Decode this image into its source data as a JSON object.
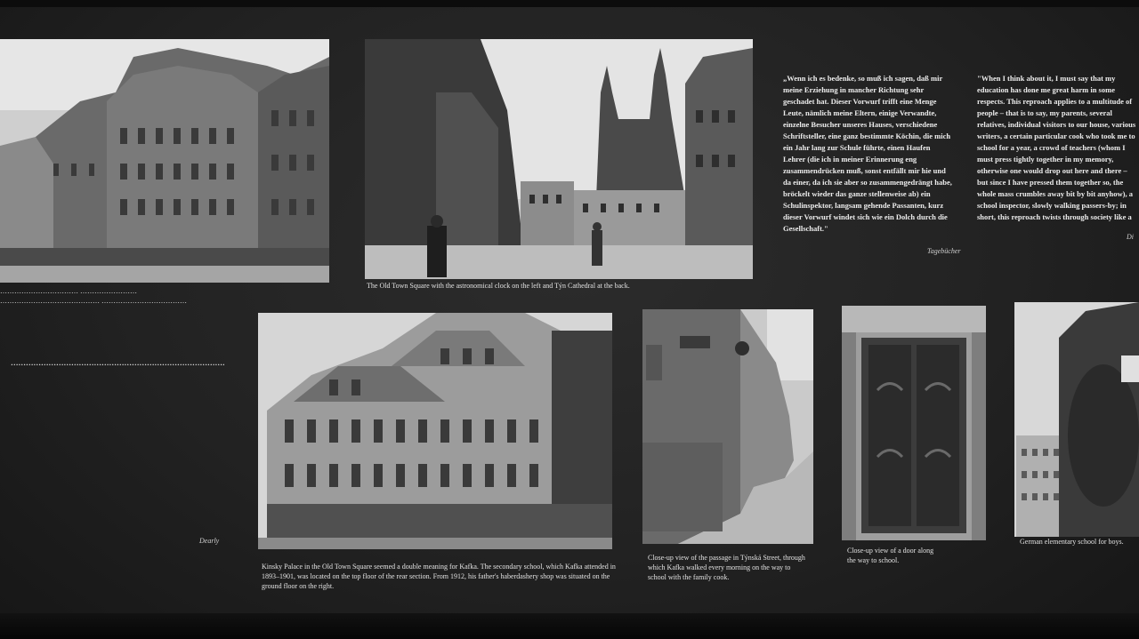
{
  "captions": {
    "top_left": "…………………………… …………………… …………………………………… ……………………………… ………………",
    "old_town_square": "The Old Town Square with the astronomical clock on the left and Týn Cathedral at the back.",
    "kinsky_palace": "Kinsky Palace in the Old Town Square seemed a double meaning for Kafka. The secondary school, which Kafka attended in 1893–1901, was located on the top floor of the rear section. From 1912, his father's haberdashery shop was situated on the ground floor on the right.",
    "passage": "Close-up view of the passage in Týnská Street, through which Kafka walked every morning on the way to school with the family cook.",
    "door": "Close-up view of a door along the way to school.",
    "school": "German elementary school for boys."
  },
  "quotes": {
    "german": "„Wenn ich es bedenke, so muß ich sagen, daß mir meine Erziehung in mancher Richtung sehr geschadet hat. Dieser Vorwurf trifft eine Menge Leute, nämlich meine Eltern, einige Verwandte, einzelne Besucher unseres Hauses, verschiedene Schriftsteller, eine ganz bestimmte Köchin, die mich ein Jahr lang zur Schule führte, einen Haufen Lehrer (die ich in meiner Erinnerung eng zusammendrücken muß, sonst entfällt mir hie und da einer, da ich sie aber so zusammengedrängt habe, bröckelt wieder das ganze stellenweise ab) ein Schulinspektor, langsam gehende Passanten, kurz dieser Vorwurf windet sich wie ein Dolch durch die Gesellschaft.\"",
    "english": "\"When I think about it, I must say that my education has done me great harm in some respects. This reproach applies to a multitude of people – that is to say, my parents, several relatives, individual visitors to our house, various writers, a certain particular cook who took me to school for a year, a crowd of teachers (whom I must press tightly together in my memory, otherwise one would drop out here and there – but since I have pressed them together so, the whole mass crumbles away bit by bit anyhow), a school inspector, slowly walking passers-by; in short, this reproach twists through society like a dagger.\"",
    "left_block": "…………………………………………………………………………………………………………………………………………………………………………………………………………………………………………………………………………………………………………………………………………………………………………………………………………………………………………………………………"
  },
  "credits": {
    "german_quote": "Tagebücher",
    "left_quote": "Dearly",
    "english_quote": "Di"
  },
  "colors": {
    "board": "#222222",
    "text": "#e8e8e8",
    "photo_dark": "#3a3a3a",
    "photo_light": "#d8d8d8"
  }
}
